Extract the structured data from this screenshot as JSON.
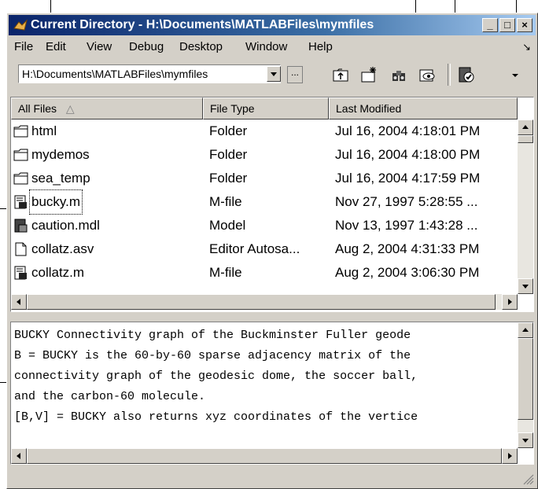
{
  "window": {
    "title": "Current Directory - H:\\Documents\\MATLABFiles\\mymfiles",
    "buttons": {
      "minimize": "_",
      "maximize": "□",
      "close": "×"
    }
  },
  "menu": {
    "items": [
      {
        "label": "File"
      },
      {
        "label": "Edit"
      },
      {
        "label": "View"
      },
      {
        "label": "Debug"
      },
      {
        "label": "Desktop"
      },
      {
        "label": "Window"
      },
      {
        "label": "Help"
      }
    ],
    "dock_glyph": "↘"
  },
  "toolbar": {
    "path_value": "H:\\Documents\\MATLABFiles\\mymfiles",
    "browse_label": "...",
    "icons": [
      "up-folder-icon",
      "new-folder-icon",
      "find-files-icon",
      "visual-directory-icon",
      "reports-icon",
      "dropdown-arrow-icon"
    ]
  },
  "file_list": {
    "columns": [
      "All Files",
      "File Type",
      "Last Modified"
    ],
    "sort_indicator": "△",
    "rows": [
      {
        "name": "html",
        "type": "Folder",
        "modified": "Jul 16, 2004 4:18:01 PM",
        "icon": "folder-icon"
      },
      {
        "name": "mydemos",
        "type": "Folder",
        "modified": "Jul 16, 2004 4:18:00 PM",
        "icon": "folder-icon"
      },
      {
        "name": "sea_temp",
        "type": "Folder",
        "modified": "Jul 16, 2004 4:17:59 PM",
        "icon": "folder-icon"
      },
      {
        "name": "bucky.m",
        "type": "M-file",
        "modified": "Nov 27, 1997 5:28:55 ...",
        "icon": "m-file-icon"
      },
      {
        "name": "caution.mdl",
        "type": "Model",
        "modified": "Nov 13, 1997 1:43:28 ...",
        "icon": "model-file-icon"
      },
      {
        "name": "collatz.asv",
        "type": "Editor Autosa...",
        "modified": "Aug 2, 2004 4:31:33 PM",
        "icon": "document-icon"
      },
      {
        "name": "collatz.m",
        "type": "M-file",
        "modified": "Aug 2, 2004 3:06:30 PM",
        "icon": "m-file-icon"
      }
    ],
    "selected_index": 3
  },
  "help_pane": {
    "lines": [
      "BUCKY  Connectivity graph of the Buckminster Fuller geode",
      "B = BUCKY is the 60-by-60 sparse adjacency matrix of the",
      "connectivity graph of the geodesic dome, the soccer ball,",
      "and the carbon-60 molecule.",
      "[B,V] = BUCKY also returns xyz coordinates of the vertice"
    ]
  },
  "colors": {
    "title_start": "#0a246a",
    "title_end": "#a6caf0",
    "chrome": "#d4d0c8"
  }
}
